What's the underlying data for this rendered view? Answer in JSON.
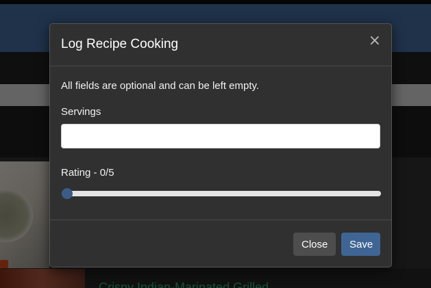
{
  "background": {
    "link_text": "Crispy Indian-Marinated Grilled..."
  },
  "modal": {
    "title": "Log Recipe Cooking",
    "close_glyph": "×",
    "note": "All fields are optional and can be left empty.",
    "servings": {
      "label": "Servings",
      "value": "",
      "placeholder": ""
    },
    "rating": {
      "label": "Rating - 0/5",
      "value": 0,
      "max": 5
    },
    "footer": {
      "close_label": "Close",
      "save_label": "Save"
    }
  },
  "colors": {
    "primary": "#3f6594",
    "modal_bg": "#303030",
    "secondary_button": "#4d4d4d",
    "link": "#29a36a"
  }
}
